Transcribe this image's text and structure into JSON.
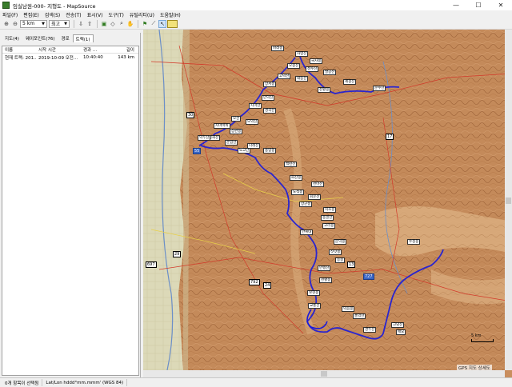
{
  "window": {
    "title": "임실남원-000- 지형도 - MapSource",
    "minimize": "—",
    "maximize": "☐",
    "close": "✕"
  },
  "menu": [
    "파일(F)",
    "편집(E)",
    "검색(S)",
    "전송(T)",
    "표시(V)",
    "도구(T)",
    "유틸리티(U)",
    "도움말(H)"
  ],
  "toolbar": {
    "zoom_level": "5 km",
    "detail": "최고"
  },
  "left_panel": {
    "tabs": [
      "지도(4)",
      "웨이포인트(76)",
      "경로",
      "트랙(1)"
    ],
    "active_tab": 3,
    "columns": [
      "이름",
      "시작 시간",
      "경과 ...",
      "길이"
    ],
    "rows": [
      [
        "현재 트랙: 201...",
        "2019-10-09 오전...",
        "10:40:40",
        "143 km"
      ]
    ]
  },
  "map": {
    "road_numbers": [
      "30",
      "55",
      "17",
      "29",
      "24",
      "13",
      "727",
      "792",
      "697"
    ],
    "labels": [
      "사령산",
      "국사봉",
      "오봉산",
      "성수산",
      "팔공산",
      "고덕산",
      "내동산",
      "상서봉",
      "천황봉",
      "문수산",
      "만덕산",
      "치마산",
      "경각산",
      "오산",
      "모악산",
      "치마바위",
      "상관봉",
      "봉화산",
      "운암산",
      "나래산",
      "용암봉",
      "백련산",
      "화산봉",
      "천마산",
      "노적봉",
      "회문산",
      "장군봉",
      "지초봉",
      "용골산",
      "고리봉",
      "문덕봉",
      "삿갓봉",
      "응봉",
      "만행산",
      "천황봉",
      "보현봉",
      "교룡산",
      "덕음봉",
      "풍악산",
      "견두산",
      "고남산",
      "매요",
      "수정봉",
      "세걸산",
      "바래봉",
      "덕두산",
      "노고단",
      "만복대"
    ],
    "scale": "5 km",
    "gps_note": "GPS 지도 상세도"
  },
  "status": {
    "selection": "0개 항목이 선택됨",
    "coord_format": "Lat/Lon hddd°mm.mmm' (WGS 84)"
  }
}
